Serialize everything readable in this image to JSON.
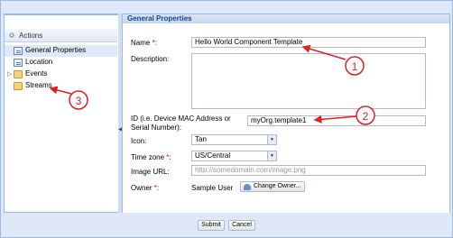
{
  "sidebar": {
    "collapse_glyph": "«",
    "actions_label": "Actions",
    "items": [
      {
        "label": "General Properties",
        "icon": "document-icon",
        "selected": true
      },
      {
        "label": "Location",
        "icon": "document-icon"
      },
      {
        "label": "Events",
        "icon": "folder-icon",
        "expandable": true
      },
      {
        "label": "Streams",
        "icon": "folder-icon"
      }
    ]
  },
  "panel": {
    "title": "General Properties"
  },
  "form": {
    "name_label": "Name",
    "name_value": "Hello World Component Template",
    "description_label": "Description:",
    "id_label_line1": "ID (i.e. Device MAC Address or",
    "id_label_line2": "Serial Number):",
    "id_value": "myOrg.template1",
    "icon_label": "Icon:",
    "icon_value": "Tan",
    "timezone_label": "Time zone",
    "timezone_value": "US/Central",
    "image_url_label": "Image URL:",
    "image_url_placeholder": "http://somedomain.com/image.png",
    "owner_label": "Owner",
    "owner_value": "Sample User",
    "change_owner_label": "Change Owner...",
    "required_mark": "*",
    "colon": ":"
  },
  "footer": {
    "submit_label": "Submit",
    "cancel_label": "Cancel"
  },
  "annotations": [
    {
      "number": "1",
      "color": "#e02020"
    },
    {
      "number": "2",
      "color": "#e02020"
    },
    {
      "number": "3",
      "color": "#e02020"
    }
  ]
}
